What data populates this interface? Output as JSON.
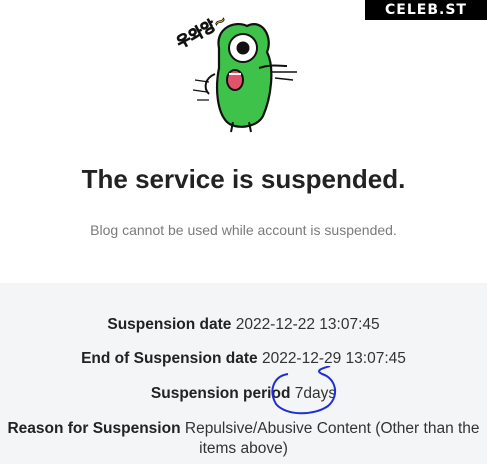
{
  "watermark": "CELEB.ST",
  "mascot_text": "우와앙~",
  "title": "The service is suspended.",
  "subtitle": "Blog cannot be used while account is suspended.",
  "info": {
    "suspension_date_label": "Suspension date",
    "suspension_date_value": "2022-12-22 13:07:45",
    "end_date_label": "End of Suspension date",
    "end_date_value": "2022-12-29 13:07:45",
    "period_label": "Suspension period",
    "period_value": "7days",
    "reason_label": "Reason for Suspension",
    "reason_value": "Repulsive/Abusive Content (Other than the items above)"
  },
  "colors": {
    "mascot_green": "#3ec24a",
    "panel_bg": "#f4f5f7",
    "annotation_blue": "#1f2fd4"
  }
}
